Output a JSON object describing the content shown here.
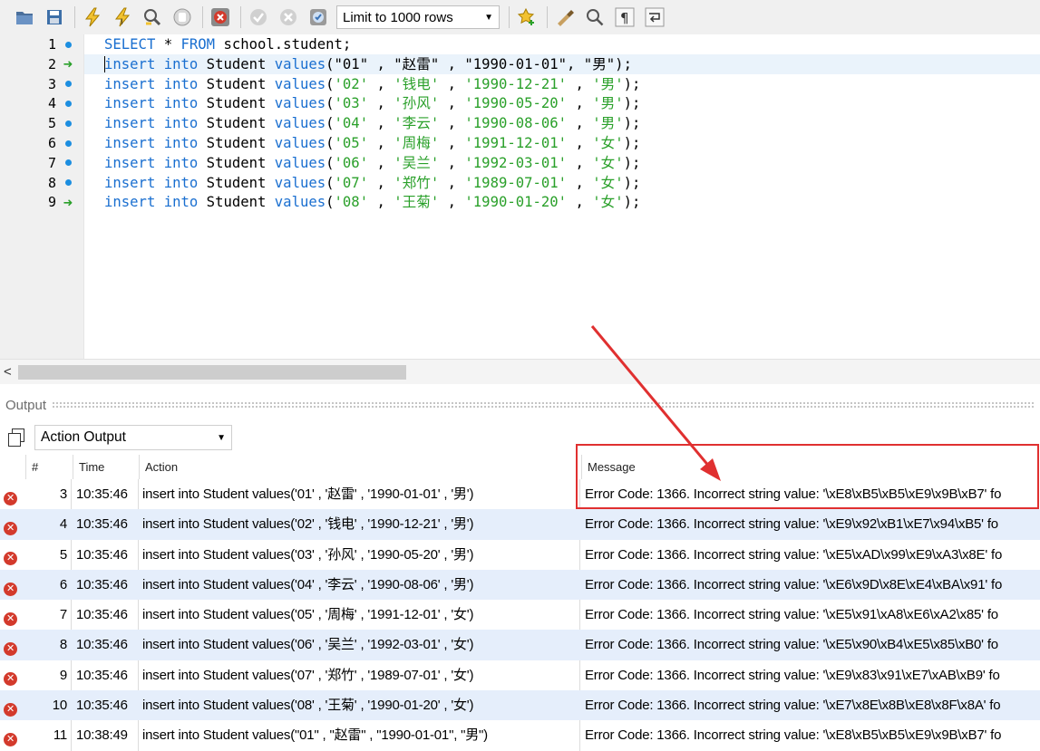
{
  "toolbar": {
    "limit_select": "Limit to 1000 rows",
    "icons": [
      "open-folder-icon",
      "save-icon",
      "execute-icon",
      "execute-current-icon",
      "explain-icon",
      "stop-icon",
      "toggle-errors-icon",
      "commit-icon",
      "rollback-icon",
      "autocommit-icon",
      "add-snippet-icon",
      "beautify-icon",
      "find-icon",
      "invisible-chars-icon",
      "wrap-icon"
    ]
  },
  "editor": {
    "line_numbers": [
      "1",
      "2",
      "3",
      "4",
      "5",
      "6",
      "7",
      "8",
      "9"
    ],
    "markers": [
      "dot",
      "arrow",
      "dot",
      "dot",
      "dot",
      "dot",
      "dot",
      "dot",
      "arrow"
    ],
    "current_line": 2,
    "lines": [
      [
        {
          "t": "SELECT",
          "c": "kw"
        },
        {
          "t": " * ",
          "c": "plain"
        },
        {
          "t": "FROM",
          "c": "kw"
        },
        {
          "t": " school.student;",
          "c": "plain"
        }
      ],
      [
        {
          "t": "insert",
          "c": "kw"
        },
        {
          "t": " ",
          "c": "plain"
        },
        {
          "t": "into",
          "c": "kw"
        },
        {
          "t": " Student ",
          "c": "plain"
        },
        {
          "t": "values",
          "c": "kw"
        },
        {
          "t": "(\"01\" , \"赵雷\" , \"1990-01-01\", \"男\");",
          "c": "plain"
        }
      ],
      [
        {
          "t": "insert",
          "c": "kw"
        },
        {
          "t": " ",
          "c": "plain"
        },
        {
          "t": "into",
          "c": "kw"
        },
        {
          "t": " Student ",
          "c": "plain"
        },
        {
          "t": "values",
          "c": "kw"
        },
        {
          "t": "(",
          "c": "plain"
        },
        {
          "t": "'02'",
          "c": "str"
        },
        {
          "t": " , ",
          "c": "plain"
        },
        {
          "t": "'钱电'",
          "c": "str"
        },
        {
          "t": " , ",
          "c": "plain"
        },
        {
          "t": "'1990-12-21'",
          "c": "str"
        },
        {
          "t": " , ",
          "c": "plain"
        },
        {
          "t": "'男'",
          "c": "str"
        },
        {
          "t": ");",
          "c": "plain"
        }
      ],
      [
        {
          "t": "insert",
          "c": "kw"
        },
        {
          "t": " ",
          "c": "plain"
        },
        {
          "t": "into",
          "c": "kw"
        },
        {
          "t": " Student ",
          "c": "plain"
        },
        {
          "t": "values",
          "c": "kw"
        },
        {
          "t": "(",
          "c": "plain"
        },
        {
          "t": "'03'",
          "c": "str"
        },
        {
          "t": " , ",
          "c": "plain"
        },
        {
          "t": "'孙风'",
          "c": "str"
        },
        {
          "t": " , ",
          "c": "plain"
        },
        {
          "t": "'1990-05-20'",
          "c": "str"
        },
        {
          "t": " , ",
          "c": "plain"
        },
        {
          "t": "'男'",
          "c": "str"
        },
        {
          "t": ");",
          "c": "plain"
        }
      ],
      [
        {
          "t": "insert",
          "c": "kw"
        },
        {
          "t": " ",
          "c": "plain"
        },
        {
          "t": "into",
          "c": "kw"
        },
        {
          "t": " Student ",
          "c": "plain"
        },
        {
          "t": "values",
          "c": "kw"
        },
        {
          "t": "(",
          "c": "plain"
        },
        {
          "t": "'04'",
          "c": "str"
        },
        {
          "t": " , ",
          "c": "plain"
        },
        {
          "t": "'李云'",
          "c": "str"
        },
        {
          "t": " , ",
          "c": "plain"
        },
        {
          "t": "'1990-08-06'",
          "c": "str"
        },
        {
          "t": " , ",
          "c": "plain"
        },
        {
          "t": "'男'",
          "c": "str"
        },
        {
          "t": ");",
          "c": "plain"
        }
      ],
      [
        {
          "t": "insert",
          "c": "kw"
        },
        {
          "t": " ",
          "c": "plain"
        },
        {
          "t": "into",
          "c": "kw"
        },
        {
          "t": " Student ",
          "c": "plain"
        },
        {
          "t": "values",
          "c": "kw"
        },
        {
          "t": "(",
          "c": "plain"
        },
        {
          "t": "'05'",
          "c": "str"
        },
        {
          "t": " , ",
          "c": "plain"
        },
        {
          "t": "'周梅'",
          "c": "str"
        },
        {
          "t": " , ",
          "c": "plain"
        },
        {
          "t": "'1991-12-01'",
          "c": "str"
        },
        {
          "t": " , ",
          "c": "plain"
        },
        {
          "t": "'女'",
          "c": "str"
        },
        {
          "t": ");",
          "c": "plain"
        }
      ],
      [
        {
          "t": "insert",
          "c": "kw"
        },
        {
          "t": " ",
          "c": "plain"
        },
        {
          "t": "into",
          "c": "kw"
        },
        {
          "t": " Student ",
          "c": "plain"
        },
        {
          "t": "values",
          "c": "kw"
        },
        {
          "t": "(",
          "c": "plain"
        },
        {
          "t": "'06'",
          "c": "str"
        },
        {
          "t": " , ",
          "c": "plain"
        },
        {
          "t": "'吴兰'",
          "c": "str"
        },
        {
          "t": " , ",
          "c": "plain"
        },
        {
          "t": "'1992-03-01'",
          "c": "str"
        },
        {
          "t": " , ",
          "c": "plain"
        },
        {
          "t": "'女'",
          "c": "str"
        },
        {
          "t": ");",
          "c": "plain"
        }
      ],
      [
        {
          "t": "insert",
          "c": "kw"
        },
        {
          "t": " ",
          "c": "plain"
        },
        {
          "t": "into",
          "c": "kw"
        },
        {
          "t": " Student ",
          "c": "plain"
        },
        {
          "t": "values",
          "c": "kw"
        },
        {
          "t": "(",
          "c": "plain"
        },
        {
          "t": "'07'",
          "c": "str"
        },
        {
          "t": " , ",
          "c": "plain"
        },
        {
          "t": "'郑竹'",
          "c": "str"
        },
        {
          "t": " , ",
          "c": "plain"
        },
        {
          "t": "'1989-07-01'",
          "c": "str"
        },
        {
          "t": " , ",
          "c": "plain"
        },
        {
          "t": "'女'",
          "c": "str"
        },
        {
          "t": ");",
          "c": "plain"
        }
      ],
      [
        {
          "t": "insert",
          "c": "kw"
        },
        {
          "t": " ",
          "c": "plain"
        },
        {
          "t": "into",
          "c": "kw"
        },
        {
          "t": " Student ",
          "c": "plain"
        },
        {
          "t": "values",
          "c": "kw"
        },
        {
          "t": "(",
          "c": "plain"
        },
        {
          "t": "'08'",
          "c": "str"
        },
        {
          "t": " , ",
          "c": "plain"
        },
        {
          "t": "'王菊'",
          "c": "str"
        },
        {
          "t": " , ",
          "c": "plain"
        },
        {
          "t": "'1990-01-20'",
          "c": "str"
        },
        {
          "t": " , ",
          "c": "plain"
        },
        {
          "t": "'女'",
          "c": "str"
        },
        {
          "t": ");",
          "c": "plain"
        }
      ]
    ]
  },
  "output": {
    "title": "Output",
    "select": "Action Output",
    "columns": {
      "num": "#",
      "time": "Time",
      "action": "Action",
      "message": "Message"
    },
    "rows": [
      {
        "num": "3",
        "time": "10:35:46",
        "action": "insert into Student values('01' , '赵雷' , '1990-01-01' , '男')",
        "message": "Error Code: 1366. Incorrect string value: '\\xE8\\xB5\\xB5\\xE9\\x9B\\xB7' fo"
      },
      {
        "num": "4",
        "time": "10:35:46",
        "action": "insert into Student values('02' , '钱电' , '1990-12-21' , '男')",
        "message": "Error Code: 1366. Incorrect string value: '\\xE9\\x92\\xB1\\xE7\\x94\\xB5' fo"
      },
      {
        "num": "5",
        "time": "10:35:46",
        "action": "insert into Student values('03' , '孙风' , '1990-05-20' , '男')",
        "message": "Error Code: 1366. Incorrect string value: '\\xE5\\xAD\\x99\\xE9\\xA3\\x8E' fo"
      },
      {
        "num": "6",
        "time": "10:35:46",
        "action": "insert into Student values('04' , '李云' , '1990-08-06' , '男')",
        "message": "Error Code: 1366. Incorrect string value: '\\xE6\\x9D\\x8E\\xE4\\xBA\\x91' fo"
      },
      {
        "num": "7",
        "time": "10:35:46",
        "action": "insert into Student values('05' , '周梅' , '1991-12-01' , '女')",
        "message": "Error Code: 1366. Incorrect string value: '\\xE5\\x91\\xA8\\xE6\\xA2\\x85' fo"
      },
      {
        "num": "8",
        "time": "10:35:46",
        "action": "insert into Student values('06' , '吴兰' , '1992-03-01' , '女')",
        "message": "Error Code: 1366. Incorrect string value: '\\xE5\\x90\\xB4\\xE5\\x85\\xB0' fo"
      },
      {
        "num": "9",
        "time": "10:35:46",
        "action": "insert into Student values('07' , '郑竹' , '1989-07-01' , '女')",
        "message": "Error Code: 1366. Incorrect string value: '\\xE9\\x83\\x91\\xE7\\xAB\\xB9' fo"
      },
      {
        "num": "10",
        "time": "10:35:46",
        "action": "insert into Student values('08' , '王菊' , '1990-01-20' , '女')",
        "message": "Error Code: 1366. Incorrect string value: '\\xE7\\x8E\\x8B\\xE8\\x8F\\x8A' fo"
      },
      {
        "num": "11",
        "time": "10:38:49",
        "action": "insert into Student values(\"01\" , \"赵雷\" , \"1990-01-01\", \"男\")",
        "message": "Error Code: 1366. Incorrect string value: '\\xE8\\xB5\\xB5\\xE9\\x9B\\xB7' fo"
      }
    ]
  },
  "colors": {
    "keyword": "#1a6fd0",
    "string": "#2aa02a",
    "error": "#d33a2c",
    "highlight": "#e03030",
    "alt_row": "#e5eefb"
  }
}
